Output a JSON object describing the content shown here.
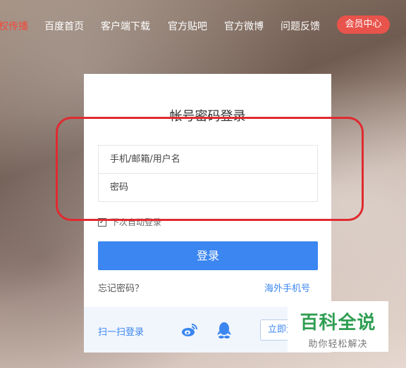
{
  "nav": {
    "items": [
      {
        "label": "权传播",
        "active": true
      },
      {
        "label": "百度首页",
        "active": false
      },
      {
        "label": "客户端下载",
        "active": false
      },
      {
        "label": "官方贴吧",
        "active": false
      },
      {
        "label": "官方微博",
        "active": false
      },
      {
        "label": "问题反馈",
        "active": false
      }
    ],
    "vip_label": "会员中心"
  },
  "login": {
    "title": "帐号密码登录",
    "username_placeholder": "手机/邮箱/用户名",
    "password_placeholder": "密码",
    "remember_label": "下次自动登录",
    "remember_checked": true,
    "submit_label": "登录",
    "forgot_label": "忘记密码？",
    "overseas_label": "海外手机号",
    "qr_label": "扫一扫登录",
    "register_label": "立即注册"
  },
  "social_icons": [
    "weibo-icon",
    "qq-icon"
  ],
  "watermark": {
    "title": "百科全说",
    "subtitle": "助你轻松解决"
  },
  "colors": {
    "accent_blue": "#3b86f0",
    "nav_active": "#f04a3c",
    "vip": "#e8534b",
    "highlight": "#e02a2f",
    "watermark_green": "#2f9e52"
  }
}
